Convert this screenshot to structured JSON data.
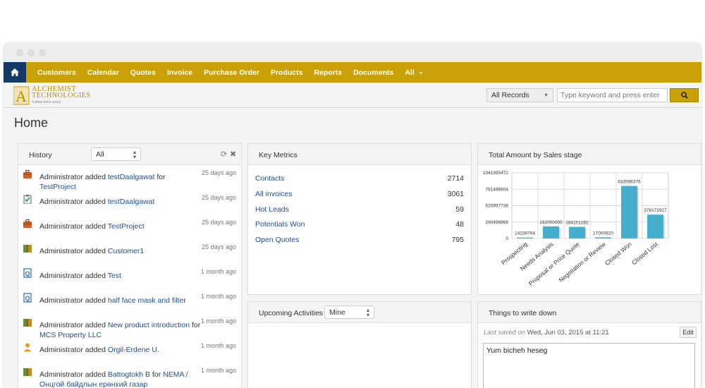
{
  "nav": {
    "items": [
      "Customers",
      "Calendar",
      "Quotes",
      "Invoice",
      "Purchase Order",
      "Products",
      "Reports",
      "Documents",
      "All"
    ]
  },
  "logo": {
    "line1": "ALCHEMIST",
    "line2": "TECHNOLOGIES",
    "tagline": "TURNS INTO GOLD"
  },
  "search": {
    "scope": "All Records",
    "placeholder": "Type keyword and press enter"
  },
  "page": {
    "title": "Home"
  },
  "history": {
    "title": "History",
    "filter": "All",
    "items": [
      {
        "icon": "briefcase-icon",
        "prefix": "Administrator added ",
        "link1": "testDaalgawat",
        "mid": " for ",
        "link2": "TestProject",
        "time": "25 days ago"
      },
      {
        "icon": "clipboard-icon",
        "prefix": "Administrator added ",
        "link1": "testDaalgawat",
        "mid": "",
        "link2": "",
        "time": "25 days ago"
      },
      {
        "icon": "briefcase-icon",
        "prefix": "Administrator added ",
        "link1": "TestProject",
        "mid": "",
        "link2": "",
        "time": "25 days ago"
      },
      {
        "icon": "book-icon",
        "prefix": "Administrator added ",
        "link1": "Customer1",
        "mid": "",
        "link2": "",
        "time": "25 days ago"
      },
      {
        "icon": "quote-icon",
        "prefix": "Administrator added ",
        "link1": "Test",
        "mid": "",
        "link2": "",
        "time": "1 month ago"
      },
      {
        "icon": "quote-icon",
        "prefix": "Administrator added ",
        "link1": "half face mask and filter",
        "mid": "",
        "link2": "",
        "time": "1 month ago"
      },
      {
        "icon": "book-icon",
        "prefix": "Administrator added ",
        "link1": "New product introduction",
        "mid": " for ",
        "link2": "MCS Property LLC",
        "time": "1 month ago"
      },
      {
        "icon": "user-icon",
        "prefix": "Administrator added ",
        "link1": "Orgil-Erdene U.",
        "mid": "",
        "link2": "",
        "time": "1 month ago"
      },
      {
        "icon": "book-icon",
        "prefix": "Administrator added ",
        "link1": "Battogtokh B",
        "mid": " for ",
        "link2": "NEMA / Онцгой байдлын ерөнхий газар",
        "time": "1 month ago"
      }
    ]
  },
  "metrics": {
    "title": "Key Metrics",
    "rows": [
      {
        "label": "Contacts",
        "value": "2714"
      },
      {
        "label": "All invoices",
        "value": "3061"
      },
      {
        "label": "Hot Leads",
        "value": "59"
      },
      {
        "label": "Potentials Won",
        "value": "48"
      },
      {
        "label": "Open Quotes",
        "value": "795"
      }
    ]
  },
  "activities": {
    "title": "Upcoming Activities",
    "filter": "Mine"
  },
  "sales": {
    "title": "Total Amount by Sales stage"
  },
  "chart_data": {
    "type": "bar",
    "title": "Total Amount by Sales stage",
    "categories": [
      "Prospecting",
      "Needs Analysis",
      "Proposal or Price Quote",
      "Negotiation or Review",
      "Closed Won",
      "Closed Lost"
    ],
    "values": [
      14238764,
      192000000,
      184101282,
      17000920,
      833596376,
      378171927
    ],
    "value_labels": [
      "14238764",
      "192000000",
      "184101282",
      "17000920",
      "833596376",
      "378171927"
    ],
    "y_ticks": [
      0,
      260498868,
      520997736,
      781496604,
      1041995472
    ],
    "ylim": [
      0,
      1041995472
    ],
    "bar_color": "#45aecb",
    "grid": true
  },
  "notes": {
    "title": "Things to write down",
    "saved_label": "Last saved on",
    "saved_date": " Wed, Jun 03, 2015 at 11:21",
    "edit_label": "Edit",
    "content": "Yum bicheh heseg"
  },
  "colors": {
    "nav": "#c9a008",
    "home": "#123a64",
    "link": "#1c4f9c",
    "bar": "#45aecb"
  }
}
